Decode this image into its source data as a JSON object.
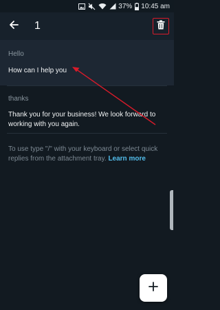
{
  "status_bar": {
    "battery_percent": "37%",
    "time": "10:45 am",
    "icons": [
      "image-icon",
      "mute-icon",
      "wifi-icon",
      "signal-icon",
      "battery-icon"
    ]
  },
  "app_bar": {
    "title": "1",
    "back_icon": "arrow-left-icon",
    "delete_icon": "trash-icon"
  },
  "quick_replies": [
    {
      "shortcut": "Hello",
      "message": "How can I help you"
    },
    {
      "shortcut": "thanks",
      "message": "Thank you for your business! We look forward to working with you again."
    }
  ],
  "help": {
    "text": "To use type \"/\" with your keyboard or select quick replies from the attachment tray. ",
    "link": "Learn more"
  },
  "fab": {
    "icon": "plus-icon"
  },
  "colors": {
    "background": "#121a21",
    "app_bar": "#17212b",
    "selected_row": "#1d2733",
    "link": "#53bdeb",
    "annotation": "#d81b2a"
  }
}
